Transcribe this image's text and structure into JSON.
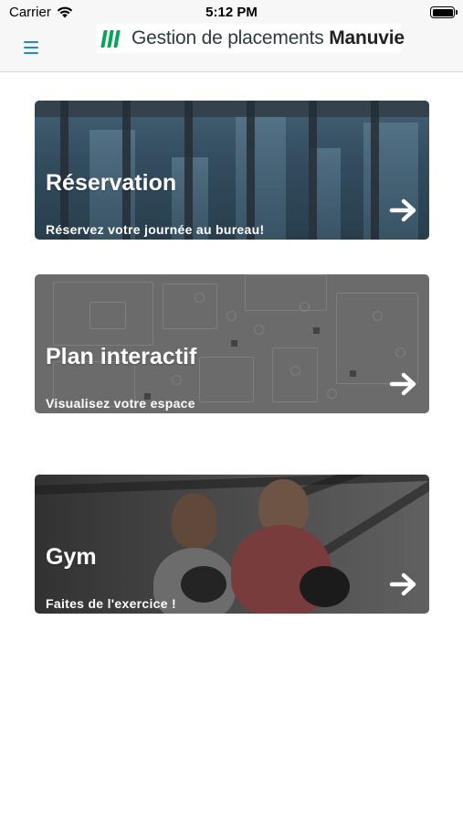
{
  "status": {
    "carrier": "Carrier",
    "time": "5:12 PM"
  },
  "header": {
    "logo_text": "Gestion de placements",
    "logo_brand": "Manuvie"
  },
  "cards": [
    {
      "title": "Réservation",
      "subtitle": "Réservez votre journée au bureau!"
    },
    {
      "title": "Plan interactif",
      "subtitle": "Visualisez votre espace"
    },
    {
      "title": "Gym",
      "subtitle": "Faites de l'exercice !"
    }
  ],
  "colors": {
    "accent": "#1e88e5",
    "brand_green": "#00a758"
  },
  "icons": {
    "menu": "hamburger-menu-icon",
    "arrow": "arrow-right-icon",
    "wifi": "wifi-icon",
    "battery": "battery-icon"
  }
}
